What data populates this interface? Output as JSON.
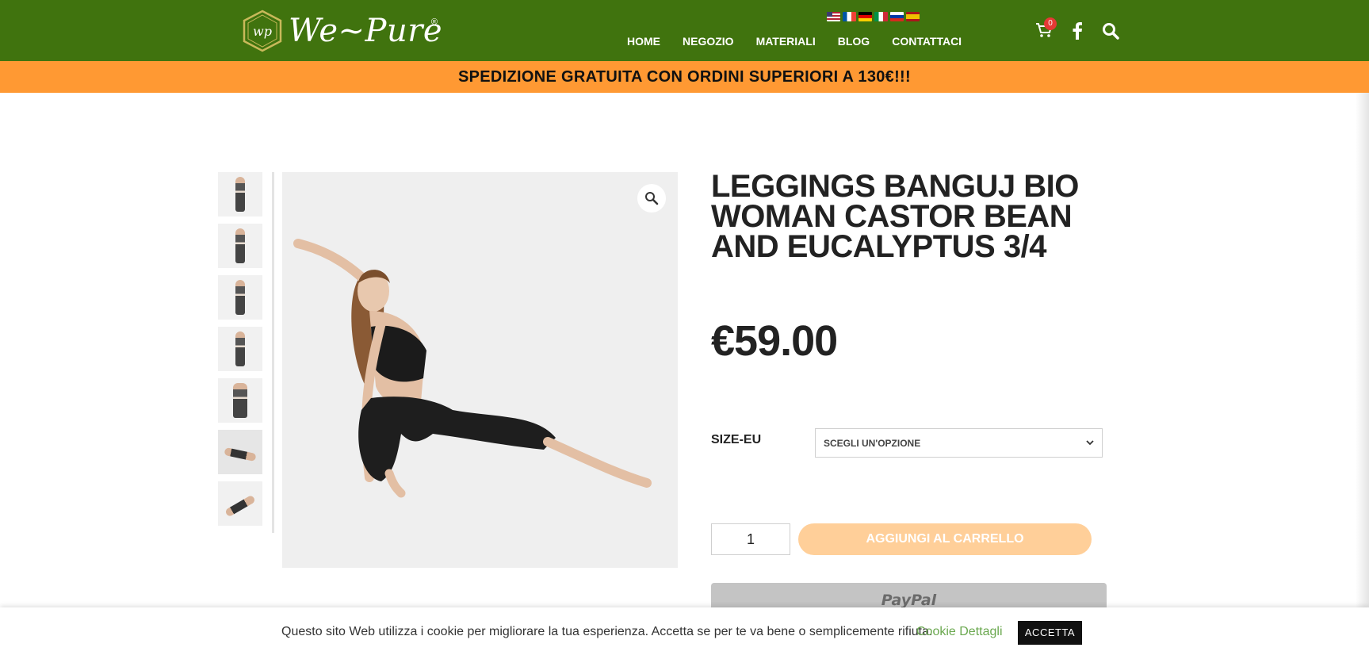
{
  "header": {
    "logo_text": "We~Pure",
    "logo_registered": "®",
    "logo_monogram": "wp",
    "nav": [
      {
        "label": "HOME"
      },
      {
        "label": "NEGOZIO"
      },
      {
        "label": "MATERIALI"
      },
      {
        "label": "BLOG"
      },
      {
        "label": "CONTATTACI"
      }
    ],
    "languages": [
      "us-flag",
      "fr-flag",
      "de-flag",
      "it-flag",
      "ru-flag",
      "es-flag"
    ],
    "cart_count": "0",
    "brand_color": "#40730e"
  },
  "banner": {
    "text": "SPEDIZIONE GRATUITA CON ORDINI SUPERIORI A 130€!!!",
    "color": "#ff9933"
  },
  "gallery": {
    "thumbnail_count": 7,
    "active_index": 5
  },
  "product": {
    "title": "LEGGINGS BANGUJ BIO WOMAN CASTOR BEAN AND EUCALYPTUS 3/4",
    "price": "€59.00",
    "size_label": "SIZE-EU",
    "size_select_value": "SCEGLI UN'OPZIONE",
    "quantity": "1",
    "add_to_cart_label": "AGGIUNGI AL CARRELLO",
    "paypal_label": "PayPal"
  },
  "cookie": {
    "text": "Questo sito Web utilizza i cookie per migliorare la tua esperienza. Accetta se per te va bene o semplicemente rifiuta.",
    "link_label": "Cookie Dettagli",
    "accept_label": "ACCETTA"
  }
}
